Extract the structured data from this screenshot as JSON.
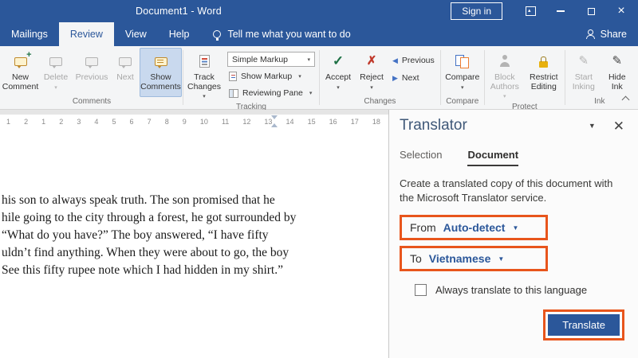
{
  "colors": {
    "accent_blue": "#2b579a",
    "annotation_orange": "#e8551c"
  },
  "title_bar": {
    "title": "Document1 - Word",
    "sign_in_label": "Sign in"
  },
  "tabs": {
    "mailings": "Mailings",
    "review": "Review",
    "view": "View",
    "help": "Help",
    "tell_me": "Tell me what you want to do",
    "share_label": "Share"
  },
  "ribbon": {
    "comments": {
      "label": "Comments",
      "new_comment": "New Comment",
      "delete": "Delete",
      "previous": "Previous",
      "next": "Next",
      "show_comments": "Show Comments"
    },
    "tracking": {
      "label": "Tracking",
      "track_changes": "Track Changes",
      "simple_markup": "Simple Markup",
      "show_markup": "Show Markup",
      "reviewing_pane": "Reviewing Pane"
    },
    "changes": {
      "label": "Changes",
      "accept": "Accept",
      "reject": "Reject",
      "previous": "Previous",
      "next": "Next"
    },
    "compare": {
      "label": "Compare",
      "compare": "Compare"
    },
    "protect": {
      "label": "Protect",
      "block_authors": "Block Authors",
      "restrict_editing": "Restrict Editing"
    },
    "ink": {
      "label": "Ink",
      "start_inking": "Start Inking",
      "hide_ink": "Hide Ink"
    }
  },
  "ruler": {
    "numbers": [
      "1",
      "2",
      "1",
      "2",
      "3",
      "4",
      "5",
      "6",
      "7",
      "8",
      "9",
      "10",
      "11",
      "12",
      "13",
      "14",
      "15",
      "16",
      "17",
      "18"
    ]
  },
  "document": {
    "lines": [
      "his son to always speak truth. The son promised that he",
      "hile going to the city through a forest, he got surrounded by",
      "“What do you have?” The boy answered, “I have fifty",
      "uldn’t find anything. When they were about to go, the boy",
      "See this fifty rupee note which I had hidden in my shirt.”"
    ]
  },
  "translator": {
    "title": "Translator",
    "tabs": {
      "selection": "Selection",
      "document": "Document"
    },
    "description": "Create a translated copy of this document with the Microsoft Translator service.",
    "from_label": "From",
    "from_value": "Auto-detect",
    "to_label": "To",
    "to_value": "Vietnamese",
    "always_translate_label": "Always translate to this language",
    "translate_button": "Translate"
  }
}
